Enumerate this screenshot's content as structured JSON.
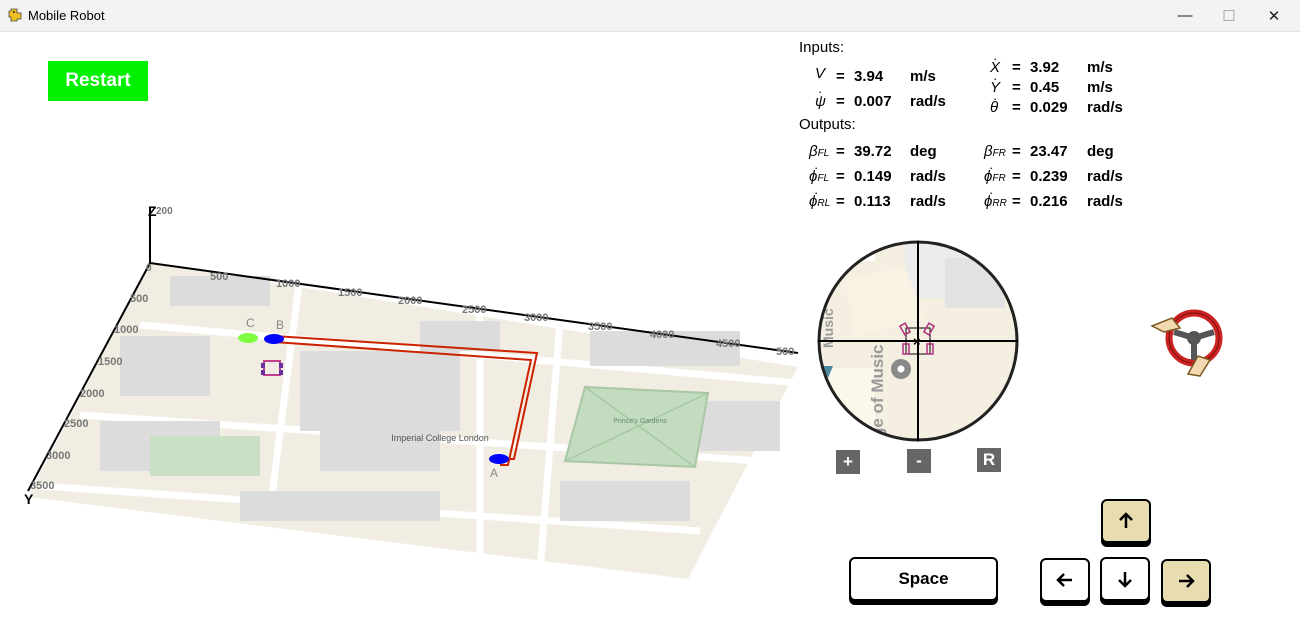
{
  "window": {
    "title": "Mobile Robot",
    "minimize": "—",
    "maximize": "☐",
    "close": "✕"
  },
  "restart_label": "Restart",
  "inputs": {
    "heading": "Inputs:",
    "V": {
      "symbol": "V",
      "value": "3.94",
      "unit": "m/s"
    },
    "psi_dot": {
      "symbol": "ψ",
      "value": "0.007",
      "unit": "rad/s"
    },
    "X_dot": {
      "symbol": "X",
      "value": "3.92",
      "unit": "m/s"
    },
    "Y_dot": {
      "symbol": "Y",
      "value": "0.45",
      "unit": "m/s"
    },
    "theta_dot": {
      "symbol": "θ",
      "value": "0.029",
      "unit": "rad/s"
    }
  },
  "outputs": {
    "heading": "Outputs:",
    "beta_FL": {
      "symbol": "β",
      "sub": "FL",
      "value": "39.72",
      "unit": "deg"
    },
    "beta_FR": {
      "symbol": "β",
      "sub": "FR",
      "value": "23.47",
      "unit": "deg"
    },
    "phi_FL": {
      "symbol": "ϕ",
      "sub": "FL",
      "value": "0.149",
      "unit": "rad/s"
    },
    "phi_FR": {
      "symbol": "ϕ",
      "sub": "FR",
      "value": "0.239",
      "unit": "rad/s"
    },
    "phi_RL": {
      "symbol": "ϕ",
      "sub": "RL",
      "value": "0.113",
      "unit": "rad/s"
    },
    "phi_RR": {
      "symbol": "ϕ",
      "sub": "RR",
      "value": "0.216",
      "unit": "rad/s"
    }
  },
  "eq": "=",
  "map": {
    "z_label": "Z",
    "z_tick": "200",
    "y_label": "Y",
    "x_ticks": [
      "500",
      "1000",
      "1500",
      "2000",
      "2500",
      "3000",
      "3500",
      "4000",
      "4500",
      "500"
    ],
    "y_ticks": [
      "500",
      "1000",
      "1500",
      "2000",
      "2500",
      "3000",
      "3500"
    ],
    "origin_tick": "0",
    "waypoints": [
      "C",
      "B",
      "A"
    ],
    "labels": {
      "college": "Imperial College London",
      "park": "Prince's Gardens"
    }
  },
  "minimap": {
    "street_a": "Music",
    "street_b": "ge of Music"
  },
  "zoom": {
    "plus": "+",
    "minus": "-",
    "reset": "R"
  },
  "keys": {
    "space": "Space"
  },
  "colors": {
    "restart": "#00f000",
    "path": "#cc2200",
    "waypoint": "#0000ff",
    "start": "#7fff40",
    "key_active": "#e8ddb0"
  }
}
